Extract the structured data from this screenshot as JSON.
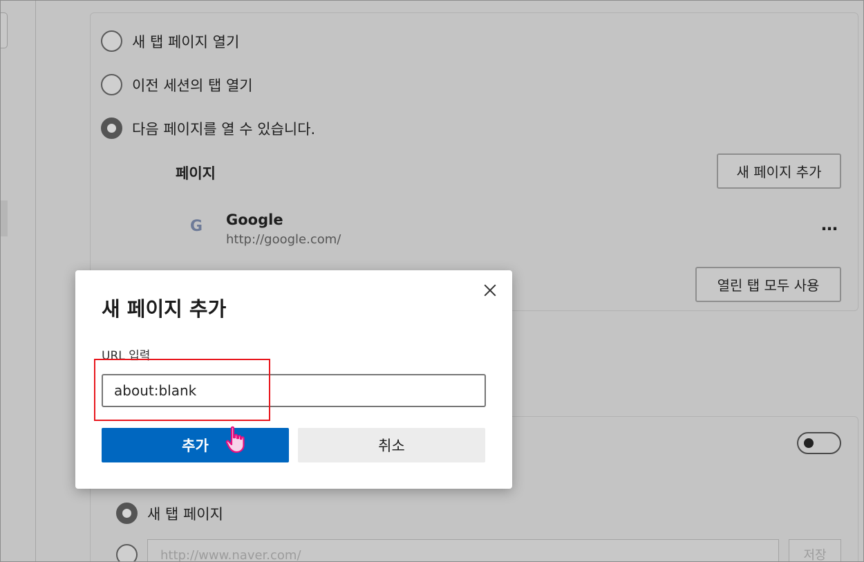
{
  "startup": {
    "options": [
      {
        "label": "새 탭 페이지 열기",
        "checked": false
      },
      {
        "label": "이전 세션의 탭 열기",
        "checked": false
      },
      {
        "label": "다음 페이지를 열 수 있습니다.",
        "checked": true
      }
    ],
    "pages_label": "페이지",
    "add_page_button": "새 페이지 추가",
    "pages": [
      {
        "icon": "google-icon",
        "icon_glyph": "G",
        "name": "Google",
        "url": "http://google.com/"
      }
    ],
    "more_glyph": "…",
    "use_all_tabs_button": "열린 탭 모두 사용"
  },
  "home": {
    "toggle_on": false,
    "option_new_tab": "새 탭 페이지",
    "url_placeholder": "http://www.naver.com/",
    "save_button": "저장"
  },
  "dialog": {
    "title": "새 페이지 추가",
    "url_label": "URL 입력",
    "url_value": "about:blank",
    "add_button": "추가",
    "cancel_button": "취소"
  },
  "colors": {
    "primary": "#0067c0",
    "highlight": "#e8151b",
    "cursor": "#e8117f"
  }
}
